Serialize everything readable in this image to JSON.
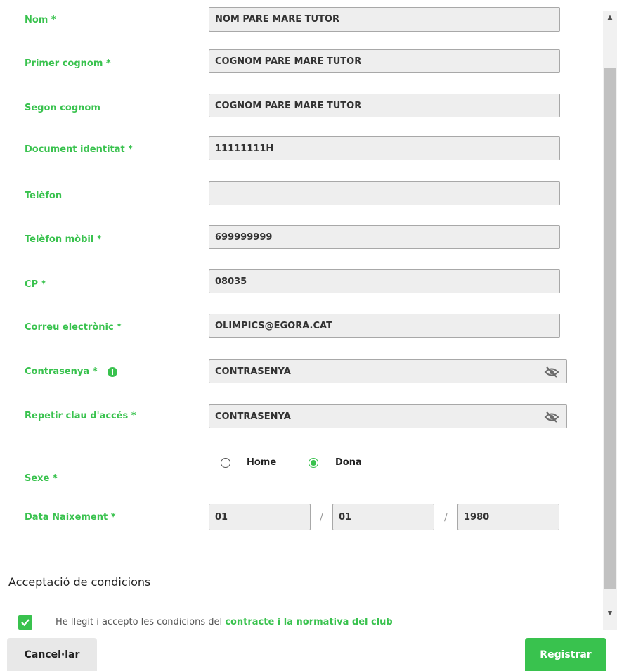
{
  "form": {
    "fields": [
      {
        "label": "Nom *",
        "value": "NOM PARE MARE TUTOR"
      },
      {
        "label": "Primer cognom *",
        "value": "COGNOM PARE MARE TUTOR"
      },
      {
        "label": "Segon cognom",
        "value": "COGNOM PARE MARE TUTOR"
      },
      {
        "label": "Document identitat *",
        "value": "11111111H"
      },
      {
        "label": "Telèfon",
        "value": ""
      },
      {
        "label": "Telèfon mòbil *",
        "value": "699999999"
      },
      {
        "label": "CP *",
        "value": "08035"
      },
      {
        "label": "Correu electrònic *",
        "value": "OLIMPICS@EGORA.CAT"
      },
      {
        "label": "Contrasenya *",
        "value": "CONTRASENYA"
      },
      {
        "label": "Repetir clau d'accés *",
        "value": "CONTRASENYA"
      }
    ],
    "sex": {
      "label": "Sexe *",
      "options": [
        "Home",
        "Dona"
      ],
      "selected": "Dona"
    },
    "birth": {
      "label": "Data Naixement *",
      "day": "01",
      "month": "01",
      "year": "1980",
      "separator": "/"
    }
  },
  "conditions": {
    "title": "Acceptació de condicions",
    "text": "He llegit i accepto les condicions del",
    "link": "contracte i la normativa del club",
    "checked": true
  },
  "buttons": {
    "cancel": "Cancel·lar",
    "submit": "Registrar"
  },
  "icons": {
    "info": "info-circle-icon",
    "eye": "eye-slash-icon",
    "check": "checkmark-icon"
  },
  "colors": {
    "accent": "#39c24e",
    "field_bg": "#eeeeee",
    "cancel_bg": "#e8e8e8"
  }
}
